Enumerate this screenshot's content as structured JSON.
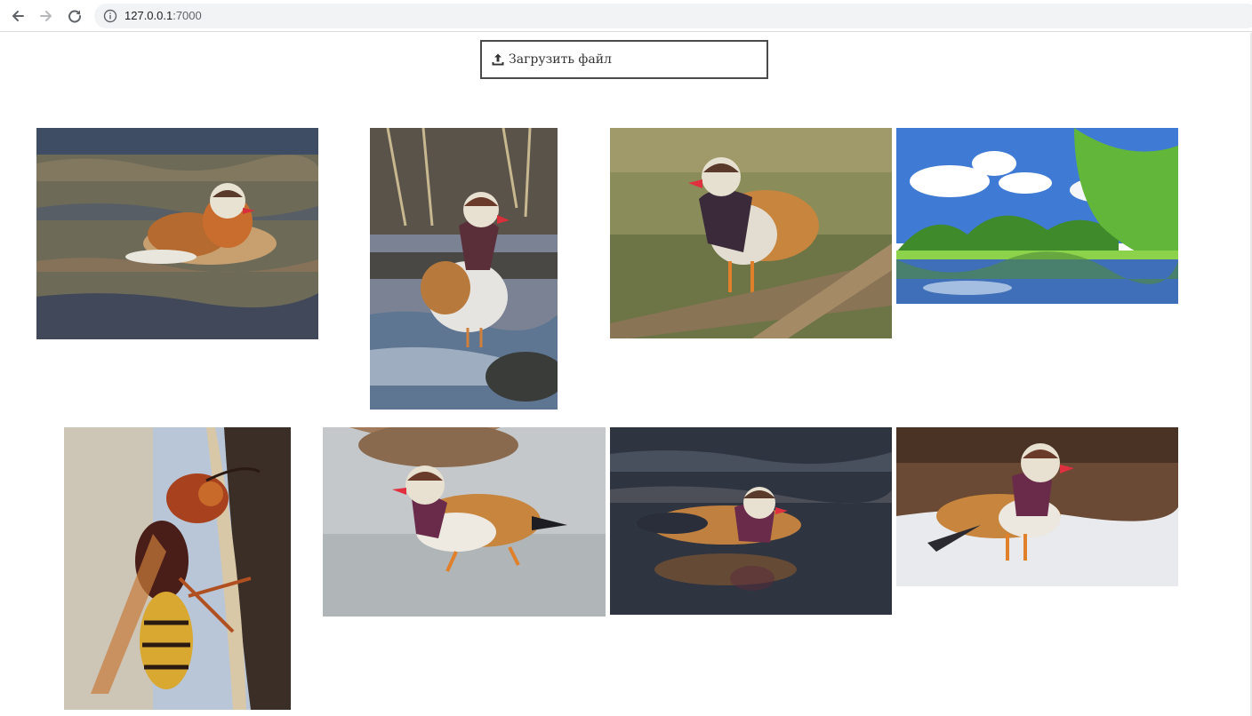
{
  "browser": {
    "url_host": "127.0.0.1",
    "url_port": ":7000",
    "icons": [
      "back-arrow-icon",
      "forward-arrow-icon",
      "reload-icon",
      "info-icon"
    ]
  },
  "upload": {
    "label": "Загрузить файл",
    "icon": "upload-icon"
  },
  "gallery": [
    {
      "subject": "mandarin-duck",
      "scene": "water"
    },
    {
      "subject": "mandarin-duck",
      "scene": "stream-rocks"
    },
    {
      "subject": "mandarin-duck",
      "scene": "log"
    },
    {
      "subject": "landscape",
      "scene": "river-trees"
    },
    {
      "subject": "hornet",
      "scene": "bark"
    },
    {
      "subject": "mandarin-duck",
      "scene": "ice"
    },
    {
      "subject": "mandarin-duck",
      "scene": "dark-water"
    },
    {
      "subject": "mandarin-duck",
      "scene": "snow"
    }
  ],
  "colors": {
    "chrome_bg": "#ffffff",
    "omnibox_bg": "#f1f3f4",
    "button_border": "#4a4a4a"
  }
}
